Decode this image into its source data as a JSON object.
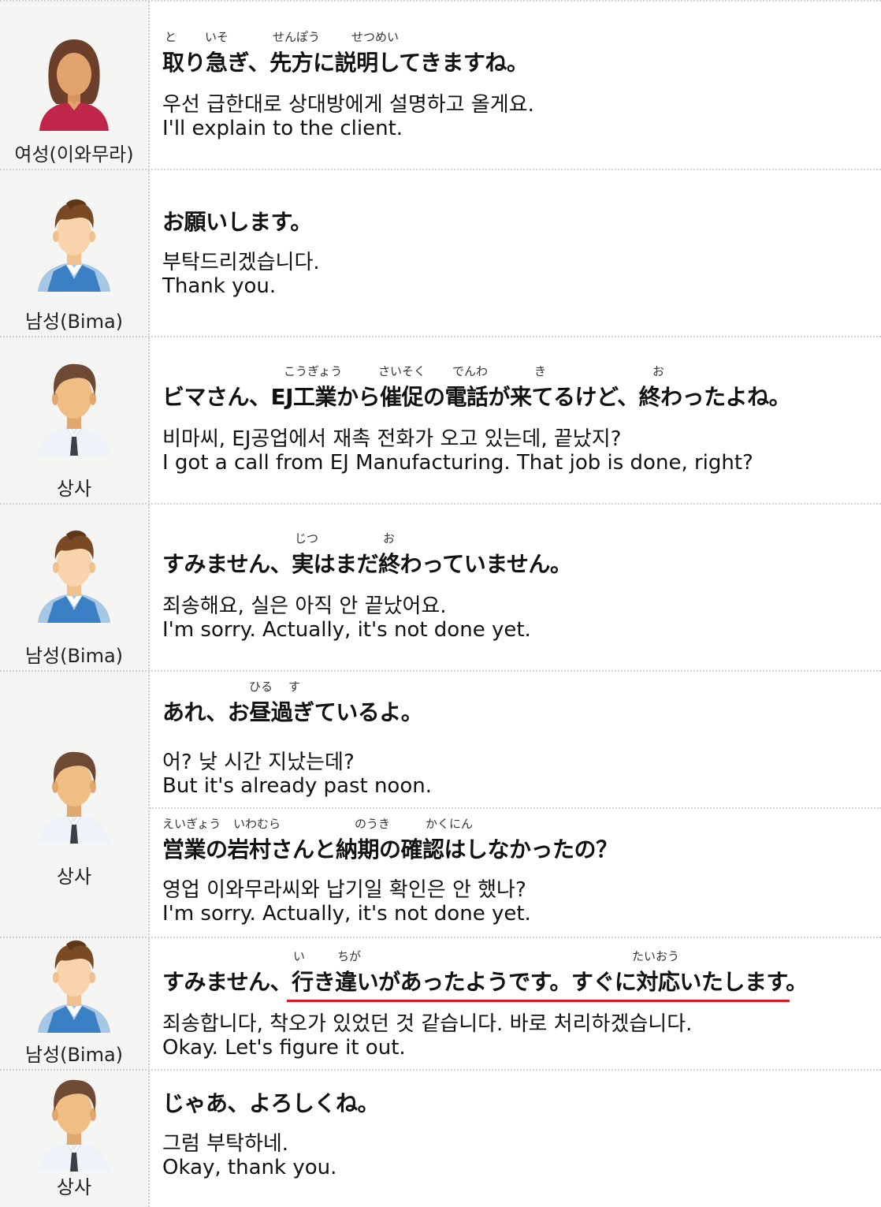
{
  "rows": [
    {
      "speaker": "여성(이와무라)",
      "avatar_icon": "woman-avatar-icon",
      "jp": "取り急ぎ、先方に説明してきますね。",
      "ruby": [
        "と",
        "いそ",
        "せんぽう",
        "せつめい"
      ],
      "ko": "우선 급한대로 상대방에게 설명하고 올게요.",
      "en": "I'll explain to the client."
    },
    {
      "speaker": "남성(Bima)",
      "avatar_icon": "man-vest-avatar-icon",
      "jp": "お願いします。",
      "ko": "부탁드리겠습니다.",
      "en": "Thank you."
    },
    {
      "speaker": "상사",
      "avatar_icon": "boss-avatar-icon",
      "jp": "ビマさん、EJ工業から催促の電話が来てるけど、終わったよね。",
      "ruby": [
        "こうぎょう",
        "さいそく",
        "でんわ",
        "き",
        "お"
      ],
      "ko": "비마씨, EJ공업에서 재촉 전화가 오고 있는데, 끝났지?",
      "en": "I got a call from EJ Manufacturing. That job is done, right?"
    },
    {
      "speaker": "남성(Bima)",
      "avatar_icon": "man-vest-avatar-icon",
      "jp": "すみません、実はまだ終わっていません。",
      "ruby": [
        "じつ",
        "お"
      ],
      "ko": "죄송해요, 실은 아직 안 끝났어요.",
      "en": "I'm sorry. Actually, it's not done yet."
    },
    {
      "speaker": "상사",
      "avatar_icon": "boss-avatar-icon",
      "jp": "あれ、お昼過ぎているよ。",
      "ruby": [
        "ひる",
        "す"
      ],
      "ko": "어? 낮 시간 지났는데?",
      "en": "But it's already past noon.",
      "jp2": "営業の岩村さんと納期の確認はしなかったの？",
      "ruby2": [
        "えいぎょう",
        "いわむら",
        "のうき",
        "かくにん"
      ],
      "ko2": "영업 이와무라씨와 납기일 확인은 안 했나?",
      "en2": "I'm sorry. Actually, it's not done yet."
    },
    {
      "speaker": "남성(Bima)",
      "avatar_icon": "man-vest-avatar-icon",
      "jp": "すみません、行き違いがあったようです。すぐに対応いたします。",
      "ruby": [
        "い",
        "ちが",
        "たいおう"
      ],
      "ko": "죄송합니다, 착오가 있었던 것 같습니다. 바로 처리하겠습니다.",
      "en": "Okay. Let's figure it out.",
      "underline_color": "#e0141e"
    },
    {
      "speaker": "상사",
      "avatar_icon": "boss-avatar-icon",
      "jp": "じゃあ、よろしくね。",
      "ko": "그럼 부탁하네.",
      "en": "Okay, thank you."
    }
  ]
}
